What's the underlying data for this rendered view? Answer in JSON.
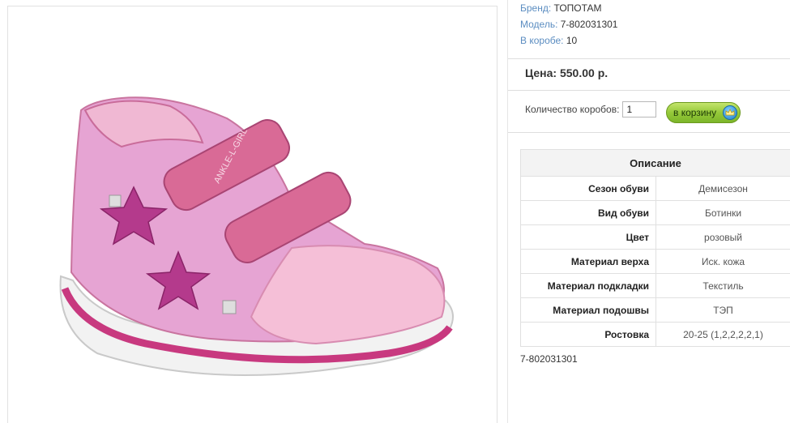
{
  "info": {
    "brand_label": "Бренд:",
    "brand_value": "ТОПОТАМ",
    "model_label": "Модель:",
    "model_value": "7-802031301",
    "box_label": "В коробе:",
    "box_value": "10"
  },
  "price": "Цена: 550.00 р.",
  "order": {
    "qty_label": "Количество коробов:",
    "qty_value": "1",
    "cart_label": "в корзину",
    "cart_icon": "crown-icon"
  },
  "description": {
    "title": "Описание",
    "rows": [
      {
        "key": "Сезон обуви",
        "value": "Демисезон"
      },
      {
        "key": "Вид обуви",
        "value": "Ботинки"
      },
      {
        "key": "Цвет",
        "value": "розовый"
      },
      {
        "key": "Материал верха",
        "value": "Иск. кожа"
      },
      {
        "key": "Материал подкладки",
        "value": "Текстиль"
      },
      {
        "key": "Материал подошвы",
        "value": "ТЭП"
      },
      {
        "key": "Ростовка",
        "value": "20-25 (1,2,2,2,2,1)"
      }
    ]
  },
  "sku_footer": "7-802031301",
  "product_image": {
    "alt": "pink-child-shoe",
    "strap_text": "ANKLE-L-GIRL"
  },
  "colors": {
    "link": "#5b8dc1",
    "button": "#95c93a",
    "shoe": "#e8a0cf"
  }
}
